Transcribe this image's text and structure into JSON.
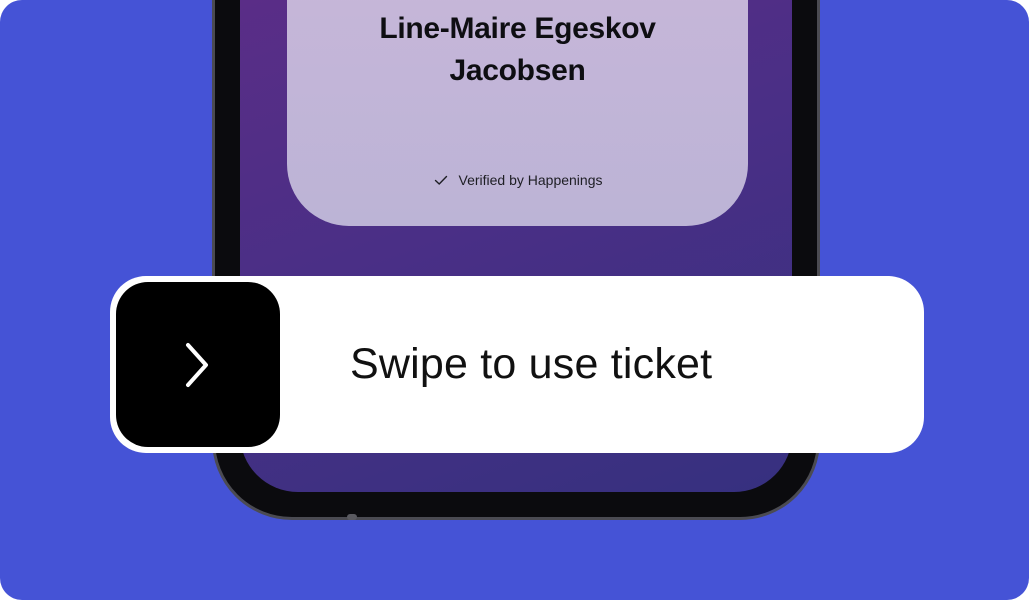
{
  "ticket": {
    "holder_name_line1": "Line-Maire Egeskov",
    "holder_name_line2": "Jacobsen",
    "verified_text": "Verified by Happenings",
    "verified_icon": "check-icon"
  },
  "swipe_control": {
    "label": "Swipe to use ticket",
    "handle_icon": "chevron-right-icon"
  },
  "colors": {
    "background": "#4553d6",
    "card": "#c3b5d8",
    "handle": "#000000"
  }
}
